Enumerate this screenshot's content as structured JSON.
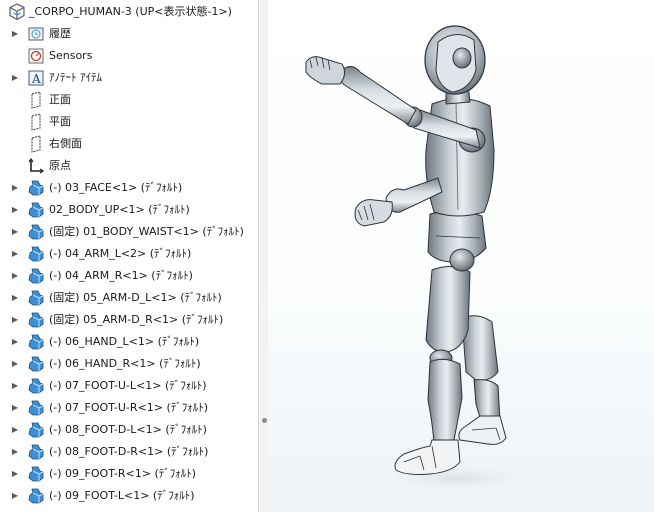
{
  "tree": {
    "root_label": "_CORPO_HUMAN-3 (UP<表示状態-1>)",
    "items": [
      {
        "label": "履歴",
        "icon": "history-icon",
        "expandable": true
      },
      {
        "label": "Sensors",
        "icon": "sensor-icon",
        "expandable": false
      },
      {
        "label": "ｱﾉﾃｰﾄ ｱｲﾃﾑ",
        "icon": "annotation-icon",
        "expandable": true
      },
      {
        "label": "正面",
        "icon": "plane-icon",
        "expandable": false
      },
      {
        "label": "平面",
        "icon": "plane-icon",
        "expandable": false
      },
      {
        "label": "右側面",
        "icon": "plane-icon",
        "expandable": false
      },
      {
        "label": "原点",
        "icon": "origin-icon",
        "expandable": false
      },
      {
        "label": "(-) 03_FACE<1> (ﾃﾞﾌｫﾙﾄ)",
        "icon": "part-icon",
        "expandable": true
      },
      {
        "label": "02_BODY_UP<1> (ﾃﾞﾌｫﾙﾄ)",
        "icon": "part-icon",
        "expandable": true
      },
      {
        "label": "(固定) 01_BODY_WAIST<1> (ﾃﾞﾌｫﾙﾄ)",
        "icon": "part-icon",
        "expandable": true
      },
      {
        "label": "(-) 04_ARM_L<2> (ﾃﾞﾌｫﾙﾄ)",
        "icon": "part-icon",
        "expandable": true
      },
      {
        "label": "(-) 04_ARM_R<1> (ﾃﾞﾌｫﾙﾄ)",
        "icon": "part-icon",
        "expandable": true
      },
      {
        "label": "(固定) 05_ARM-D_L<1> (ﾃﾞﾌｫﾙﾄ)",
        "icon": "part-icon",
        "expandable": true
      },
      {
        "label": "(固定) 05_ARM-D_R<1> (ﾃﾞﾌｫﾙﾄ)",
        "icon": "part-icon",
        "expandable": true
      },
      {
        "label": "(-) 06_HAND_L<1> (ﾃﾞﾌｫﾙﾄ)",
        "icon": "part-icon",
        "expandable": true
      },
      {
        "label": "(-) 06_HAND_R<1> (ﾃﾞﾌｫﾙﾄ)",
        "icon": "part-icon",
        "expandable": true
      },
      {
        "label": "(-) 07_FOOT-U-L<1> (ﾃﾞﾌｫﾙﾄ)",
        "icon": "part-icon",
        "expandable": true
      },
      {
        "label": "(-) 07_FOOT-U-R<1> (ﾃﾞﾌｫﾙﾄ)",
        "icon": "part-icon",
        "expandable": true
      },
      {
        "label": "(-) 08_FOOT-D-L<1> (ﾃﾞﾌｫﾙﾄ)",
        "icon": "part-icon",
        "expandable": true
      },
      {
        "label": "(-) 08_FOOT-D-R<1> (ﾃﾞﾌｫﾙﾄ)",
        "icon": "part-icon",
        "expandable": true
      },
      {
        "label": "(-) 09_FOOT-R<1> (ﾃﾞﾌｫﾙﾄ)",
        "icon": "part-icon",
        "expandable": true
      },
      {
        "label": "(-) 09_FOOT-L<1> (ﾃﾞﾌｫﾙﾄ)",
        "icon": "part-icon",
        "expandable": true
      }
    ]
  },
  "viewport": {
    "model_name": "humanoid-robot-model"
  },
  "colors": {
    "part_icon_blue": "#3d8fd6",
    "model_gray": "#9aa2aa"
  }
}
